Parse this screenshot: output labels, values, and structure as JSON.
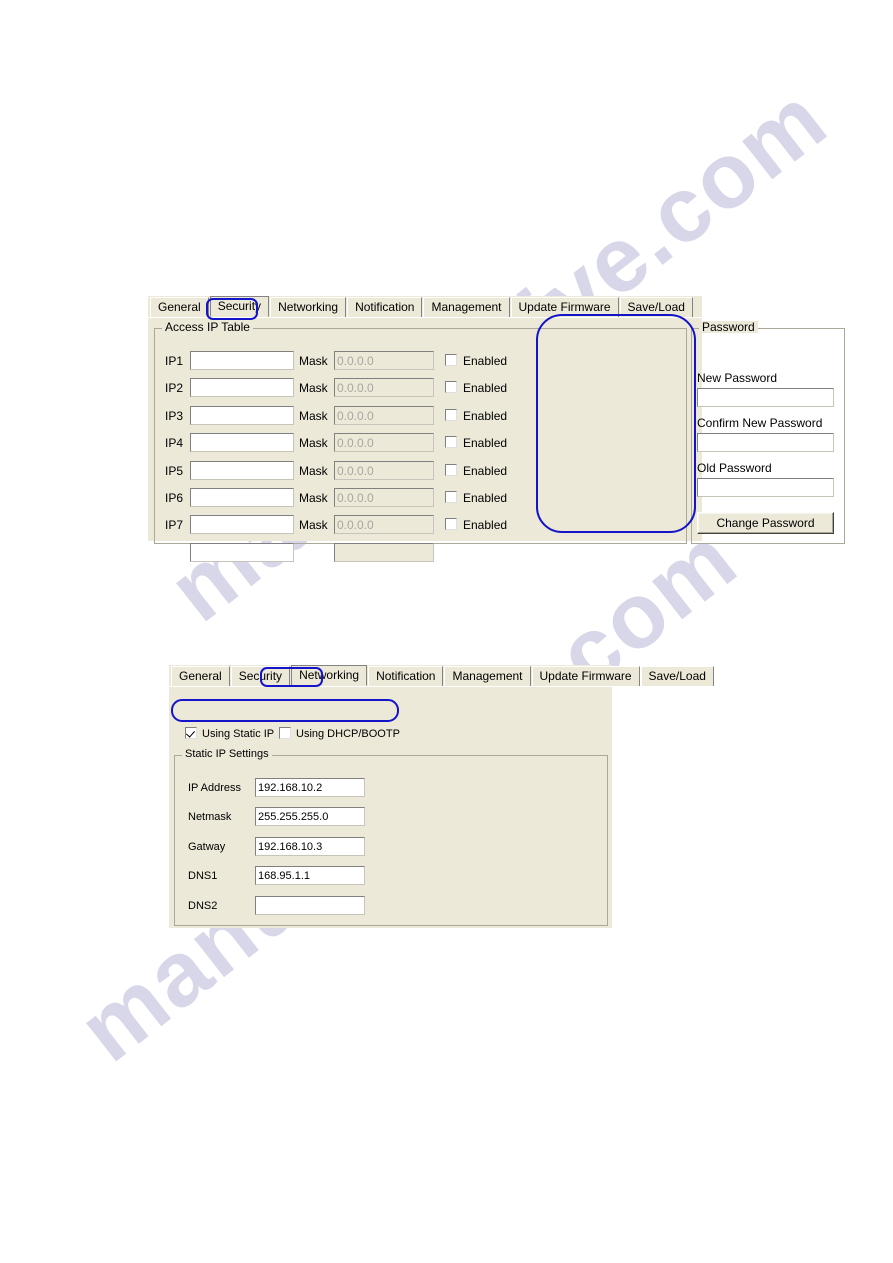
{
  "page": {
    "watermark": "manualshive.com"
  },
  "security_panel": {
    "tabs": [
      {
        "label": "General",
        "selected": false
      },
      {
        "label": "Security",
        "selected": true
      },
      {
        "label": "Networking",
        "selected": false
      },
      {
        "label": "Notification",
        "selected": false
      },
      {
        "label": "Management",
        "selected": false
      },
      {
        "label": "Update Firmware",
        "selected": false
      },
      {
        "label": "Save/Load",
        "selected": false
      }
    ],
    "access_ip_table": {
      "title": "Access IP Table",
      "mask_label": "Mask",
      "enabled_label": "Enabled",
      "rows": [
        {
          "name": "IP1",
          "ip": "",
          "mask": "0.0.0.0",
          "enabled": false
        },
        {
          "name": "IP2",
          "ip": "",
          "mask": "0.0.0.0",
          "enabled": false
        },
        {
          "name": "IP3",
          "ip": "",
          "mask": "0.0.0.0",
          "enabled": false
        },
        {
          "name": "IP4",
          "ip": "",
          "mask": "0.0.0.0",
          "enabled": false
        },
        {
          "name": "IP5",
          "ip": "",
          "mask": "0.0.0.0",
          "enabled": false
        },
        {
          "name": "IP6",
          "ip": "",
          "mask": "0.0.0.0",
          "enabled": false
        },
        {
          "name": "IP7",
          "ip": "",
          "mask": "0.0.0.0",
          "enabled": false
        }
      ]
    },
    "password": {
      "title": "Password",
      "new_password_label": "New Password",
      "new_password_value": "",
      "confirm_password_label": "Confirm New Password",
      "confirm_password_value": "",
      "old_password_label": "Old Password",
      "old_password_value": "",
      "change_button": "Change Password"
    },
    "annotation_color": "#1414c8"
  },
  "networking_panel": {
    "tabs": [
      {
        "label": "General",
        "selected": false
      },
      {
        "label": "Security",
        "selected": false
      },
      {
        "label": "Networking",
        "selected": true
      },
      {
        "label": "Notification",
        "selected": false
      },
      {
        "label": "Management",
        "selected": false
      },
      {
        "label": "Update Firmware",
        "selected": false
      },
      {
        "label": "Save/Load",
        "selected": false
      }
    ],
    "ip_mode": {
      "static_label": "Using Static IP",
      "static_checked": true,
      "dhcp_label": "Using DHCP/BOOTP",
      "dhcp_checked": false
    },
    "static_ip_settings": {
      "title": "Static IP Settings",
      "fields": [
        {
          "label": "IP Address",
          "value": "192.168.10.2"
        },
        {
          "label": "Netmask",
          "value": "255.255.255.0"
        },
        {
          "label": "Gatway",
          "value": "192.168.10.3"
        },
        {
          "label": "DNS1",
          "value": "168.95.1.1"
        },
        {
          "label": "DNS2",
          "value": ""
        }
      ]
    },
    "annotation_color": "#1414c8"
  }
}
